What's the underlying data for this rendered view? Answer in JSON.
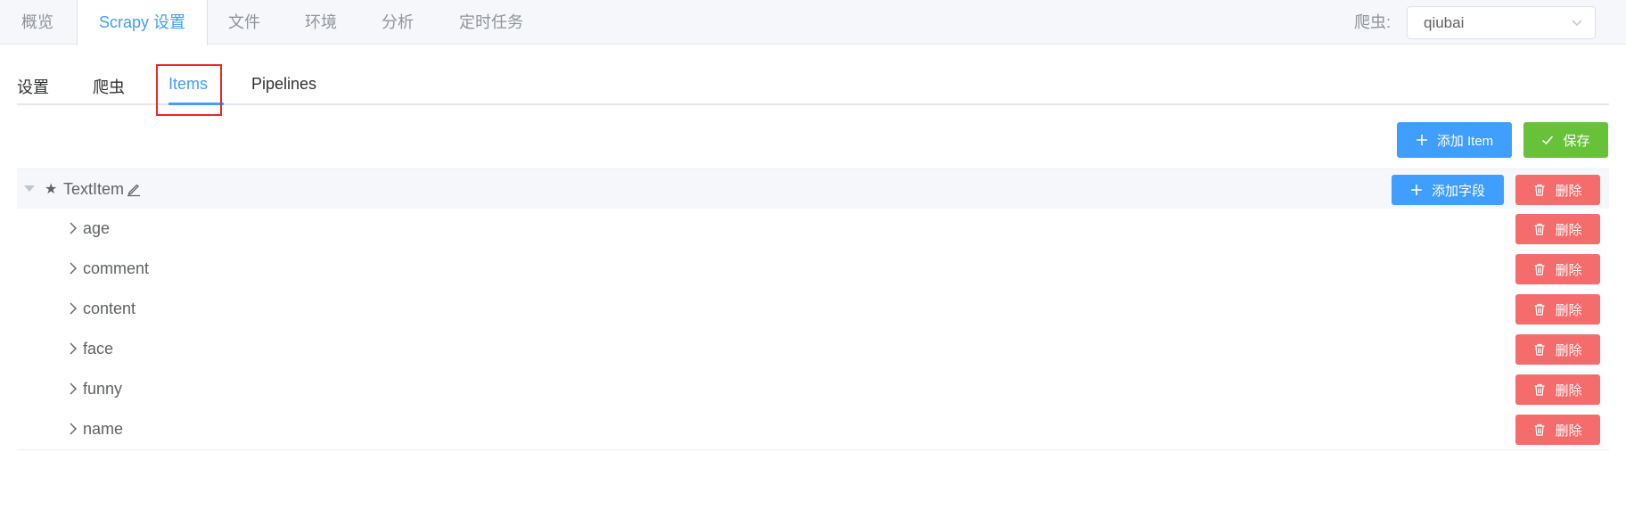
{
  "top_tabs": [
    {
      "label": "概览",
      "active": false
    },
    {
      "label": "Scrapy 设置",
      "active": true
    },
    {
      "label": "文件",
      "active": false
    },
    {
      "label": "环境",
      "active": false
    },
    {
      "label": "分析",
      "active": false
    },
    {
      "label": "定时任务",
      "active": false
    }
  ],
  "spider_selector": {
    "label": "爬虫:",
    "value": "qiubai",
    "icon": "chevron-down-icon"
  },
  "inner_tabs": [
    {
      "label": "设置",
      "active": false
    },
    {
      "label": "爬虫",
      "active": false
    },
    {
      "label": "Items",
      "active": true
    },
    {
      "label": "Pipelines",
      "active": false
    }
  ],
  "toolbar": {
    "add_item_label": "添加 Item",
    "save_label": "保存"
  },
  "tree": {
    "root": {
      "label": "TextItem",
      "add_field_label": "添加字段",
      "delete_label": "删除"
    },
    "fields": [
      {
        "label": "age",
        "delete_label": "删除"
      },
      {
        "label": "comment",
        "delete_label": "删除"
      },
      {
        "label": "content",
        "delete_label": "删除"
      },
      {
        "label": "face",
        "delete_label": "删除"
      },
      {
        "label": "funny",
        "delete_label": "删除"
      },
      {
        "label": "name",
        "delete_label": "删除"
      }
    ]
  },
  "colors": {
    "primary": "#409eff",
    "success": "#67c23a",
    "danger": "#f56c6c",
    "highlight": "#e8262b"
  }
}
